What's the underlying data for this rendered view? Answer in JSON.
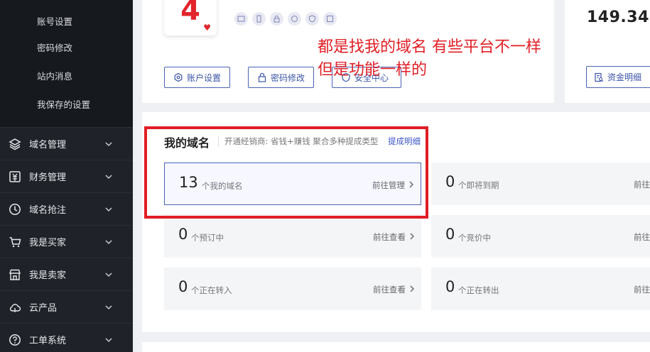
{
  "sidebar": {
    "sub_items": [
      "账号设置",
      "密码修改",
      "站内消息",
      "我保存的设置"
    ],
    "menu": [
      {
        "label": "域名管理",
        "icon": "layers-icon"
      },
      {
        "label": "财务管理",
        "icon": "finance-icon"
      },
      {
        "label": "域名抢注",
        "icon": "clock-icon"
      },
      {
        "label": "我是买家",
        "icon": "cart-icon"
      },
      {
        "label": "我是卖家",
        "icon": "store-icon"
      },
      {
        "label": "云产品",
        "icon": "cloud-icon"
      },
      {
        "label": "工单系统",
        "icon": "help-icon"
      }
    ]
  },
  "profile": {
    "level": "4",
    "buttons": {
      "account": "账户设置",
      "password": "密码修改",
      "security": "安全中心"
    }
  },
  "finance": {
    "balance": "149.34",
    "detail_button": "资金明细"
  },
  "annotation": {
    "line1": "都是找我的域名  有些平台不一样",
    "line2": "但是功能一样的"
  },
  "domains": {
    "title": "我的域名",
    "subtitle": "开通经销商: 省钱+赚钱 聚合多种提成类型",
    "link": "提成明细",
    "stats": [
      {
        "count": "13",
        "unit": "个我的域名",
        "action": "前往管理"
      },
      {
        "count": "0",
        "unit": "个即将到期",
        "action": "前往"
      },
      {
        "count": "0",
        "unit": "个预订中",
        "action": "前往查看"
      },
      {
        "count": "0",
        "unit": "个竞价中",
        "action": "前往"
      },
      {
        "count": "0",
        "unit": "个正在转入",
        "action": "前往查看"
      },
      {
        "count": "0",
        "unit": "个正在转出",
        "action": "前往"
      }
    ]
  },
  "colors": {
    "sidebar_bg": "#1f2329",
    "accent": "#3b55a8",
    "annotation_red": "#e01f26",
    "level_red": "#e1252b"
  }
}
